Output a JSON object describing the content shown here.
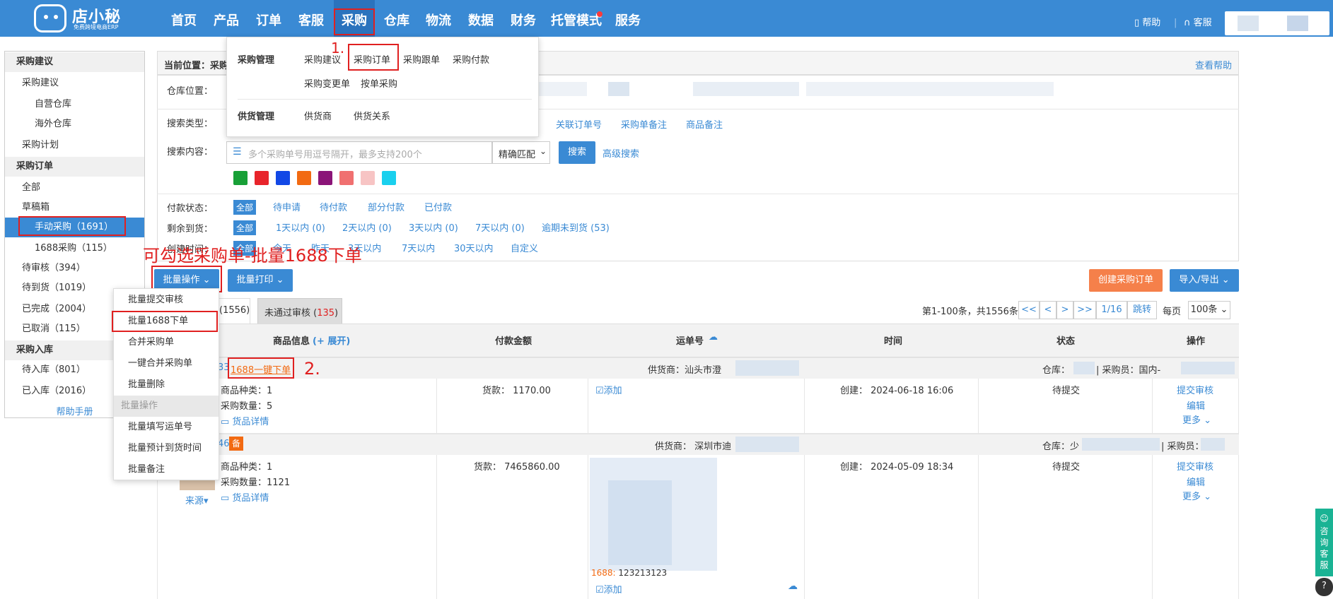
{
  "header": {
    "brand": "店小秘",
    "brand_sub": "免费跨境电商ERP",
    "nav": [
      "首页",
      "产品",
      "订单",
      "客服",
      "采购",
      "仓库",
      "物流",
      "数据",
      "财务",
      "托管模式",
      "服务"
    ],
    "help": "帮助",
    "service": "客服"
  },
  "dropdown": {
    "group1_title": "采购管理",
    "group1_items": [
      "采购建议",
      "采购订单",
      "采购跟单",
      "采购付款",
      "采购变更单",
      "按单采购"
    ],
    "group2_title": "供货管理",
    "group2_items": [
      "供货商",
      "供货关系"
    ],
    "step1": "1."
  },
  "sidebar": {
    "items": [
      {
        "label": "采购建议",
        "type": "h"
      },
      {
        "label": "采购建议",
        "type": "l1"
      },
      {
        "label": "自营仓库",
        "type": "l2"
      },
      {
        "label": "海外仓库",
        "type": "l2"
      },
      {
        "label": "采购计划",
        "type": "l1"
      },
      {
        "label": "采购订单",
        "type": "h"
      },
      {
        "label": "全部",
        "type": "l1"
      },
      {
        "label": "草稿箱",
        "type": "l1"
      },
      {
        "label": "手动采购（1691）",
        "type": "sel"
      },
      {
        "label": "1688采购（115）",
        "type": "l2"
      },
      {
        "label": "待审核（394）",
        "type": "l1"
      },
      {
        "label": "待到货（1019）",
        "type": "l1"
      },
      {
        "label": "已完成（2004）",
        "type": "l1"
      },
      {
        "label": "已取消（115）",
        "type": "l1"
      },
      {
        "label": "采购入库",
        "type": "h"
      },
      {
        "label": "待入库（801）",
        "type": "l1"
      },
      {
        "label": "已入库（2016）",
        "type": "l1"
      },
      {
        "label": "帮助手册",
        "type": "help"
      }
    ]
  },
  "breadcrumb": {
    "label": "当前位置：采购",
    "help": "查看帮助"
  },
  "filters": {
    "warehouse_label": "仓库位置：",
    "search_type_label": "搜索类型：",
    "search_type_links": [
      "关联订单号",
      "采购单备注",
      "商品备注"
    ],
    "search_content_label": "搜索内容：",
    "search_placeholder": "多个采购单号用逗号隔开，最多支持200个",
    "match_mode": "精确匹配",
    "search_btn": "搜索",
    "advanced": "高级搜索",
    "swatch_colors": [
      "#18a037",
      "#e8242b",
      "#1248e6",
      "#f26a12",
      "#8b1478",
      "#f07070",
      "#f7c4c4",
      "#1ad0ee"
    ],
    "pay_status_label": "付款状态：",
    "pay_status_options": [
      "全部",
      "待申请",
      "待付款",
      "部分付款",
      "已付款"
    ],
    "arrival_label": "剩余到货：",
    "arrival_options": [
      "全部",
      "1天以内 (0)",
      "2天以内 (0)",
      "3天以内 (0)",
      "7天以内 (0)",
      "逾期未到货 (53)"
    ],
    "created_label": "创建时间：",
    "created_options": [
      "全部",
      "今天",
      "昨天",
      "3天以内",
      "7天以内",
      "30天以内",
      "自定义"
    ]
  },
  "toolbar": {
    "batch_ops": "批量操作",
    "batch_print": "批量打印",
    "create_order": "创建采购订单",
    "import_export": "导入/导出",
    "annotation": "可勾选采购单-批量1688下单"
  },
  "batch_menu": {
    "items": [
      "批量提交审核",
      "批量1688下单",
      "合并采购单",
      "一键合并采购单",
      "批量删除"
    ],
    "section": "批量操作",
    "items2": [
      "批量填写运单号",
      "批量预计到货时间",
      "批量备注"
    ]
  },
  "tabs": {
    "tab1_count": "(1556)",
    "tab2_label": "未通过审核 (",
    "tab2_count": "135",
    "tab2_end": ")"
  },
  "pagination": {
    "summary": "第1-100条，共1556条",
    "buttons": [
      "<<",
      "<",
      ">",
      ">>"
    ],
    "page": "1/16",
    "jump": "跳转",
    "per_page_label": "每页",
    "per_page": "100条"
  },
  "table": {
    "headers": [
      "商品信息",
      "(+ 展开)",
      "付款金额",
      "运单号",
      "时间",
      "状态",
      "操作"
    ],
    "row1": {
      "order_prefix": "33",
      "order_link": "1688一键下单",
      "step2": "2.",
      "supplier": "供货商：汕头市澄",
      "warehouse": "仓库：",
      "buyer": "| 采购员：国内-",
      "kinds": "商品种类：1",
      "qty": "采购数量：5",
      "detail": "货品详情",
      "amount": "货款：  1170.00",
      "add": "添加",
      "created": "创建：  2024-06-18 16:06",
      "status": "待提交",
      "ops": [
        "提交审核",
        "编辑",
        "更多"
      ]
    },
    "row2": {
      "order_prefix": "46",
      "badge": "备",
      "supplier": "供货商：  深圳市迪",
      "warehouse": "仓库：少",
      "buyer": "| 采购员：",
      "kinds": "商品种类：1",
      "qty": "采购数量：1121",
      "detail": "货品详情",
      "source": "来源",
      "amount": "货款：  7465860.00",
      "tracking_prefix": "1688:",
      "tracking": "123213123",
      "add": "添加",
      "created": "创建：  2024-05-09 18:34",
      "status": "待提交",
      "ops": [
        "提交审核",
        "编辑",
        "更多"
      ]
    }
  },
  "side_tab": "咨询客服",
  "help_q": "?"
}
